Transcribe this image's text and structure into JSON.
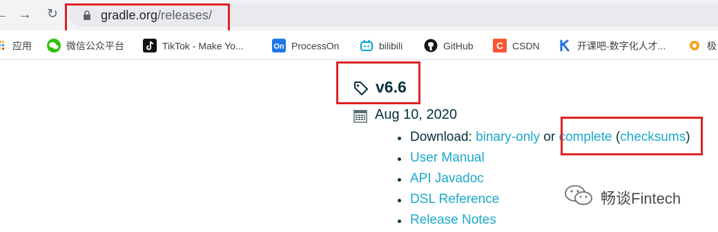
{
  "browser": {
    "url_host": "gradle.org",
    "url_path": "/releases/"
  },
  "bookmarks": [
    {
      "label": "应用",
      "icon": "apps-grid-icon"
    },
    {
      "label": "微信公众平台",
      "icon": "wechat-icon"
    },
    {
      "label": "TikTok - Make Yo...",
      "icon": "tiktok-icon"
    },
    {
      "label": "ProcessOn",
      "icon": "processon-icon"
    },
    {
      "label": "bilibili",
      "icon": "bilibili-icon"
    },
    {
      "label": "GitHub",
      "icon": "github-icon"
    },
    {
      "label": "CSDN",
      "icon": "csdn-icon"
    },
    {
      "label": "开课吧-数字化人才...",
      "icon": "kaikeba-icon"
    },
    {
      "label": "极",
      "icon": "bookmark-icon"
    }
  ],
  "release": {
    "version": "v6.6",
    "date": "Aug 10, 2020",
    "download_prefix": "Download: ",
    "binary_only": "binary-only",
    "or": " or ",
    "complete": "complete",
    "checksums_open": " (",
    "checksums": "checksums",
    "checksums_close": ")",
    "links": [
      "User Manual",
      "API Javadoc",
      "DSL Reference",
      "Release Notes"
    ]
  },
  "watermark": {
    "text": "畅谈Fintech"
  },
  "colors": {
    "highlight": "#e02020",
    "link": "#1ba8cb",
    "text": "#02303a"
  }
}
